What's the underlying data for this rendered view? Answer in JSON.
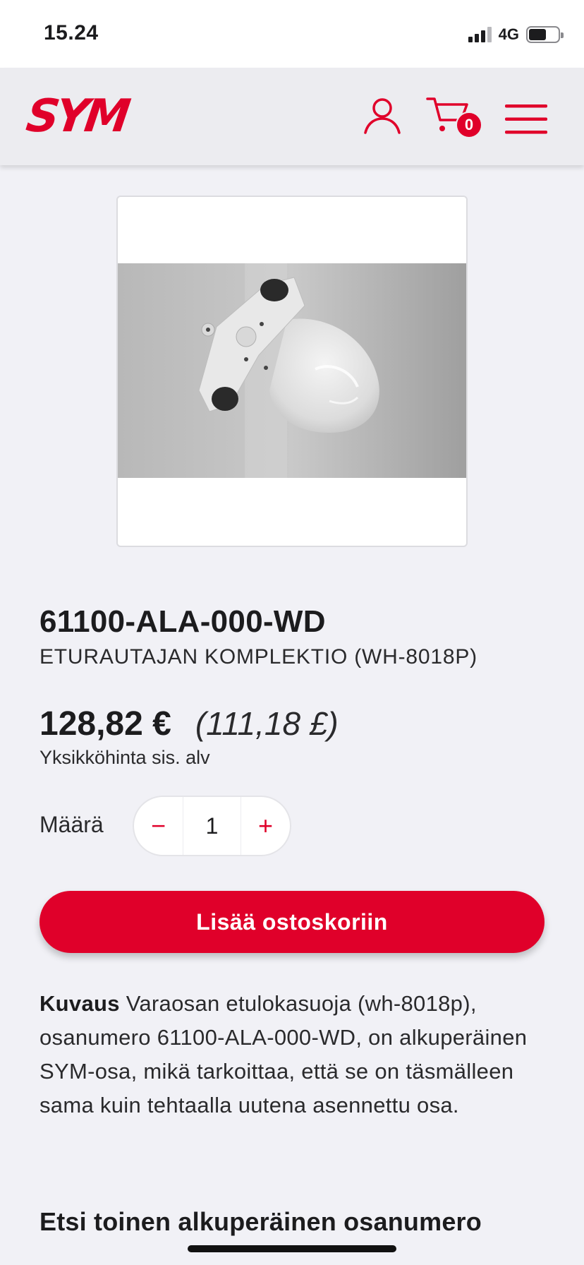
{
  "status_bar": {
    "time": "15.24",
    "network": "4G"
  },
  "header": {
    "logo_text": "SYM",
    "cart_count": "0",
    "icons": {
      "account": "user-icon",
      "cart": "cart-icon",
      "menu": "menu-icon"
    },
    "brand_color": "#e0002a"
  },
  "product": {
    "part_number": "61100-ALA-000-WD",
    "name": "ETURAUTAJAN KOMPLEKTIO (WH-8018P)",
    "price_eur": "128,82 €",
    "price_gbp": "(111,18 £)",
    "price_note": "Yksikköhinta sis. alv",
    "quantity_label": "Määrä",
    "quantity": "1",
    "minus": "−",
    "plus": "+",
    "add_to_cart": "Lisää ostoskoriin",
    "description_label": "Kuvaus",
    "description_text": "Varaosan etulokasuoja (wh-8018p), osanumero 61100-ALA-000-WD, on alkuperäinen SYM-osa, mikä tarkoittaa, että se on täsmälleen sama kuin tehtaalla uutena asennettu osa."
  },
  "search_section": {
    "heading": "Etsi toinen alkuperäinen osanumero"
  }
}
